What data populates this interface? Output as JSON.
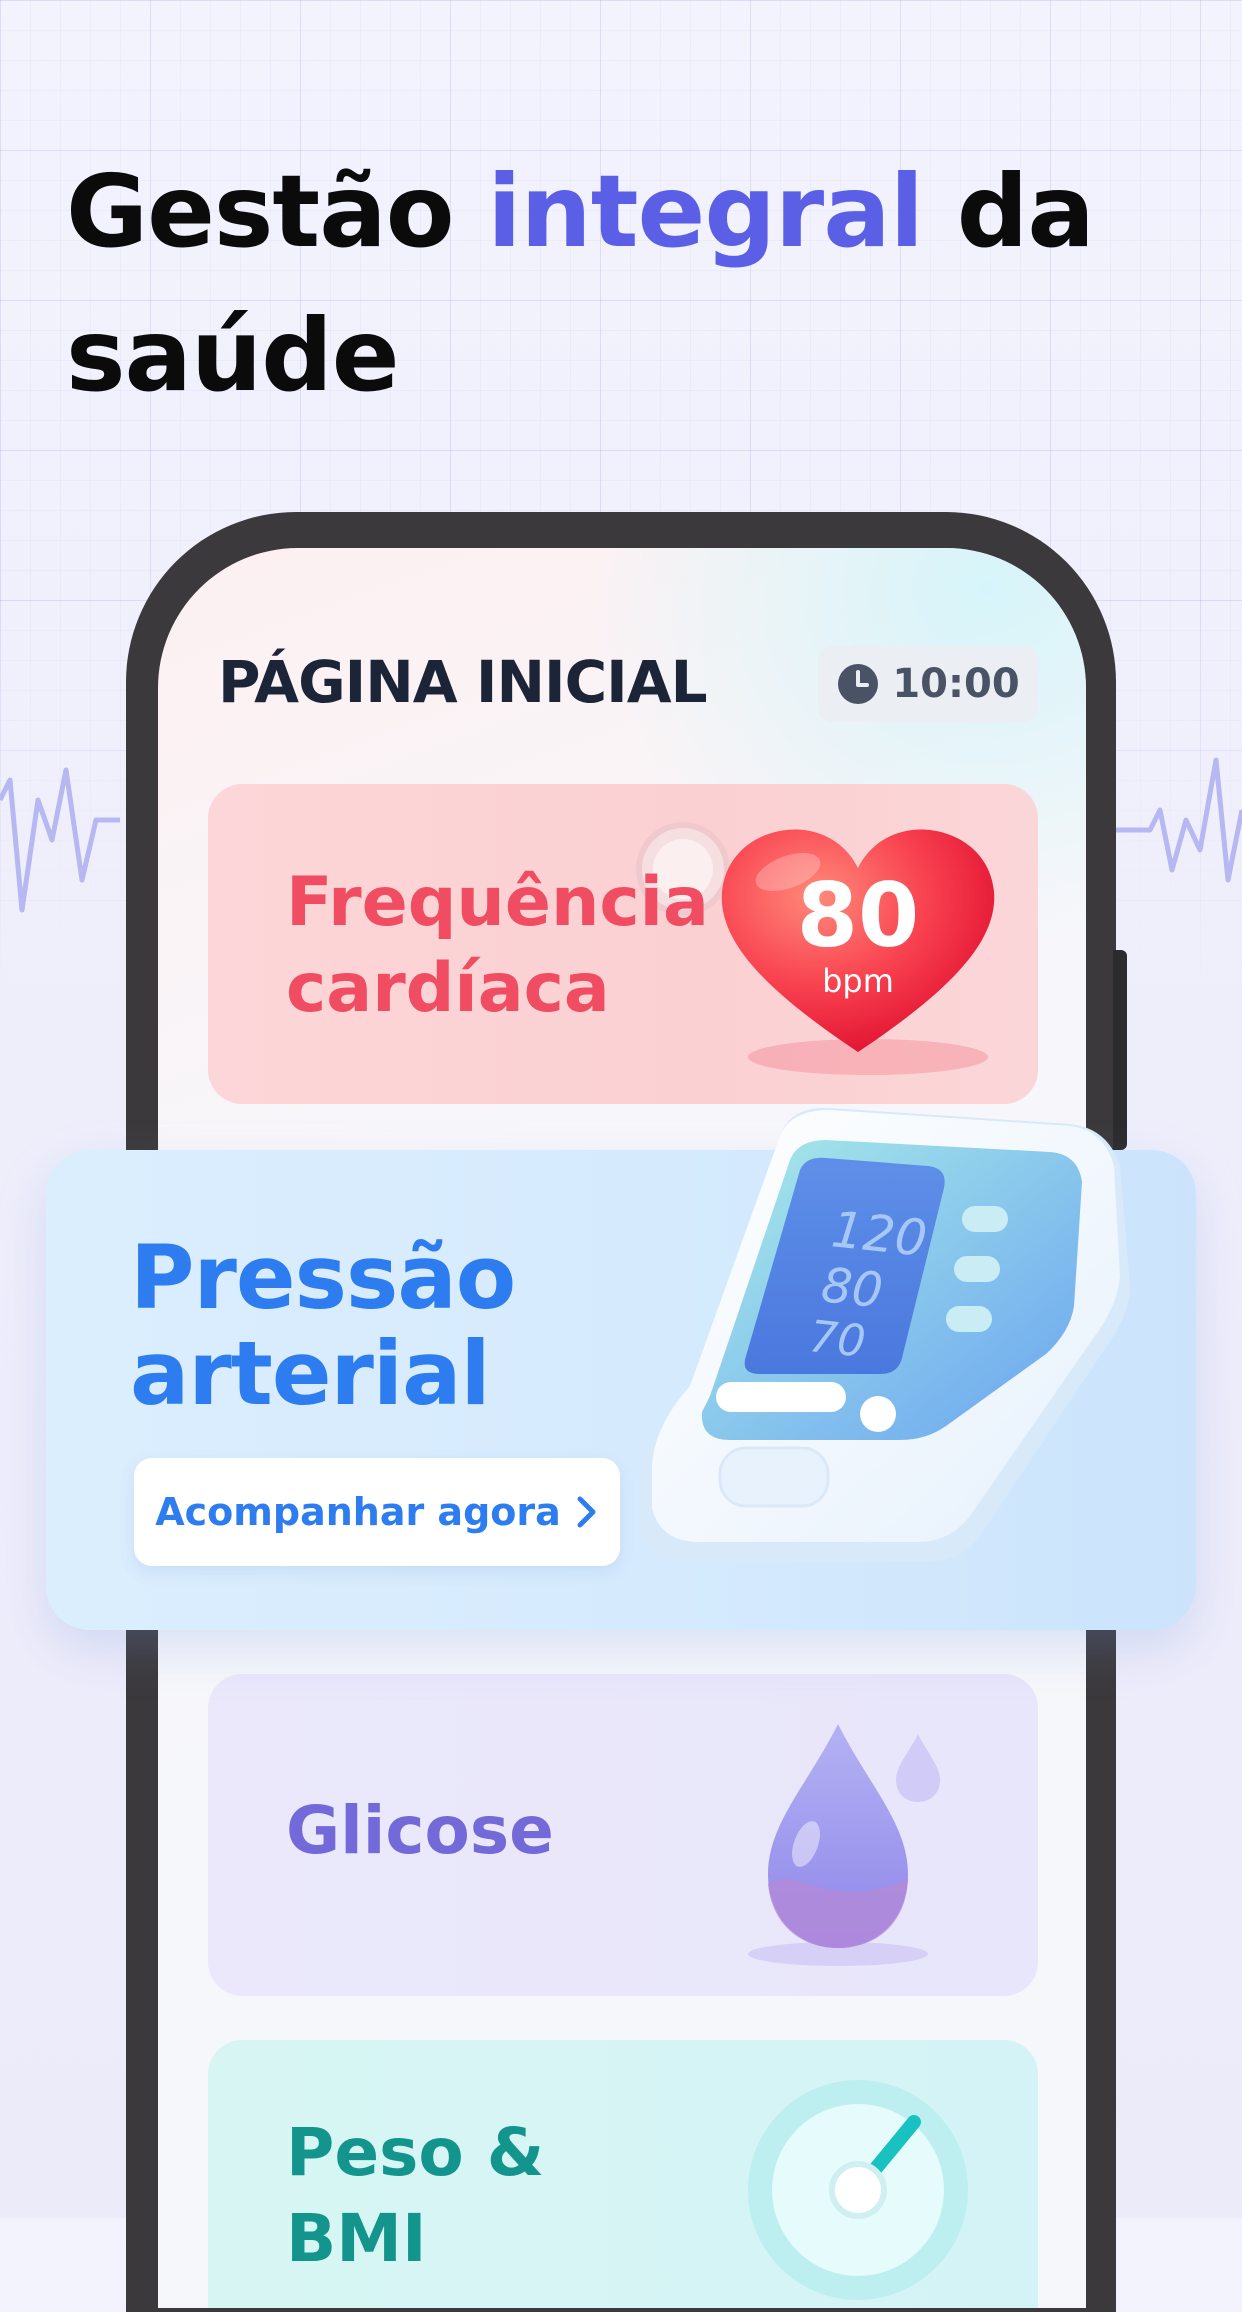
{
  "headline": {
    "part1": "Gestão ",
    "accent": "integral",
    "part2": " da",
    "line2": "saúde"
  },
  "colors": {
    "accent": "#5b5fe6",
    "heart": "#f04c62",
    "blood_pressure": "#2d7cf0",
    "glucose": "#7469d8",
    "weight": "#13958e"
  },
  "app": {
    "home_title": "PÁGINA INICIAL",
    "time": "10:00",
    "clock_icon": "clock-icon"
  },
  "heart_rate": {
    "label_line1": "Frequência",
    "label_line2": "cardíaca",
    "value": "80",
    "unit": "bpm",
    "icon": "heart-icon"
  },
  "blood_pressure": {
    "title_line1": "Pressão",
    "title_line2": "arterial",
    "cta": "Acompanhar agora",
    "cta_icon": "chevron-right-icon",
    "monitor_readings": [
      "120",
      "80",
      "70"
    ]
  },
  "glucose": {
    "label": "Glicose",
    "icon": "droplet-icon"
  },
  "weight": {
    "label_line1": "Peso &",
    "label_line2": "BMI",
    "icon": "scale-gauge-icon"
  }
}
